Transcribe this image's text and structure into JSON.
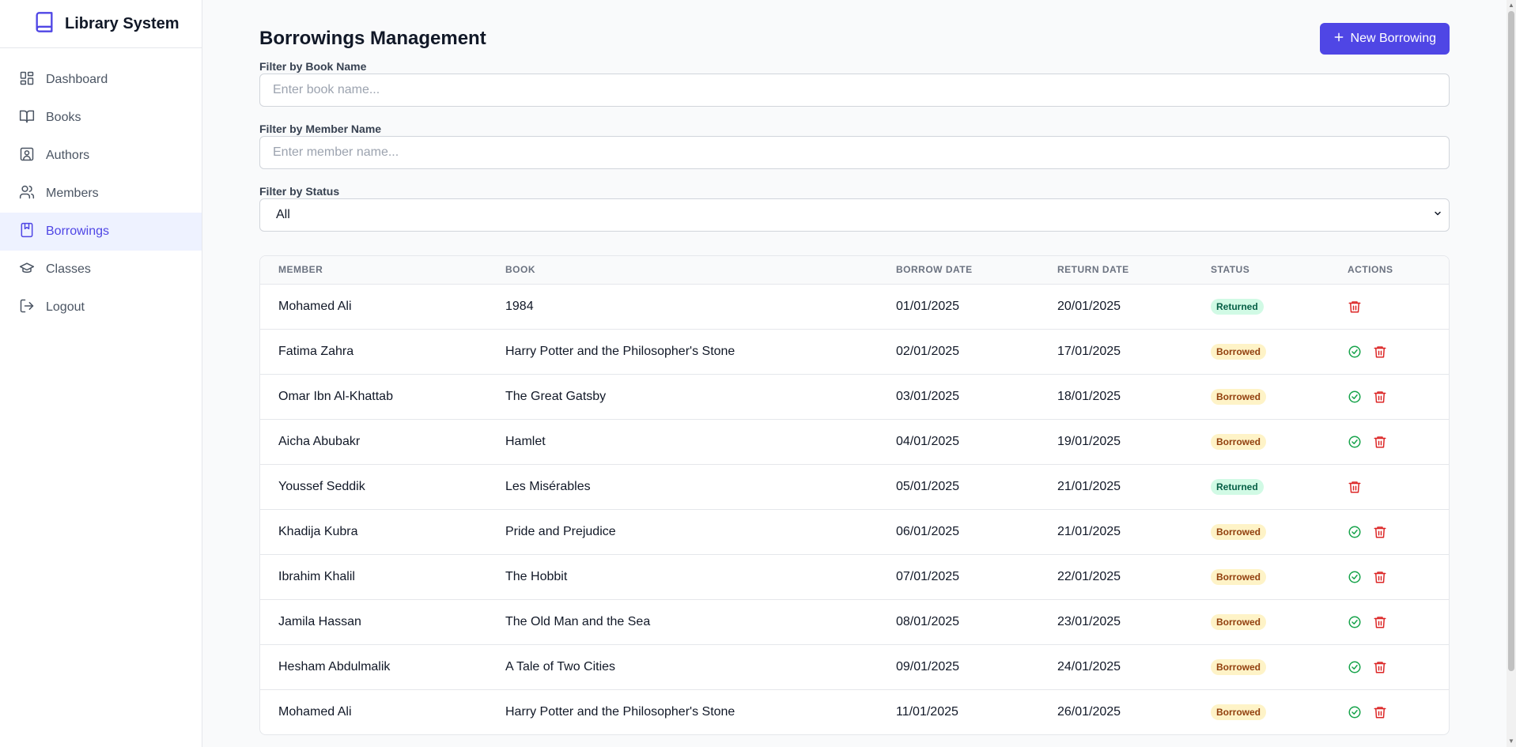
{
  "app": {
    "title": "Library System"
  },
  "colors": {
    "accent": "#4f46e5",
    "returned_bg": "#d1fae5",
    "borrowed_bg": "#fef3c7",
    "delete": "#dc2626",
    "approve": "#16a34a"
  },
  "sidebar": {
    "items": [
      {
        "label": "Dashboard",
        "icon": "dashboard-icon"
      },
      {
        "label": "Books",
        "icon": "book-open-icon"
      },
      {
        "label": "Authors",
        "icon": "author-icon"
      },
      {
        "label": "Members",
        "icon": "users-icon"
      },
      {
        "label": "Borrowings",
        "icon": "bookmark-book-icon",
        "active": true
      },
      {
        "label": "Classes",
        "icon": "graduation-cap-icon"
      },
      {
        "label": "Logout",
        "icon": "logout-icon"
      }
    ]
  },
  "header": {
    "title": "Borrowings Management",
    "new_button": "New Borrowing"
  },
  "filters": {
    "book": {
      "label": "Filter by Book Name",
      "placeholder": "Enter book name..."
    },
    "member": {
      "label": "Filter by Member Name",
      "placeholder": "Enter member name..."
    },
    "status": {
      "label": "Filter by Status",
      "selected": "All"
    }
  },
  "table": {
    "columns": [
      "Member",
      "Book",
      "Borrow Date",
      "Return Date",
      "Status",
      "Actions"
    ],
    "rows": [
      {
        "member": "Mohamed Ali",
        "book": "1984",
        "borrow_date": "01/01/2025",
        "return_date": "20/01/2025",
        "status": "Returned"
      },
      {
        "member": "Fatima Zahra",
        "book": "Harry Potter and the Philosopher's Stone",
        "borrow_date": "02/01/2025",
        "return_date": "17/01/2025",
        "status": "Borrowed"
      },
      {
        "member": "Omar Ibn Al-Khattab",
        "book": "The Great Gatsby",
        "borrow_date": "03/01/2025",
        "return_date": "18/01/2025",
        "status": "Borrowed"
      },
      {
        "member": "Aicha Abubakr",
        "book": "Hamlet",
        "borrow_date": "04/01/2025",
        "return_date": "19/01/2025",
        "status": "Borrowed"
      },
      {
        "member": "Youssef Seddik",
        "book": "Les Misérables",
        "borrow_date": "05/01/2025",
        "return_date": "21/01/2025",
        "status": "Returned"
      },
      {
        "member": "Khadija Kubra",
        "book": "Pride and Prejudice",
        "borrow_date": "06/01/2025",
        "return_date": "21/01/2025",
        "status": "Borrowed"
      },
      {
        "member": "Ibrahim Khalil",
        "book": "The Hobbit",
        "borrow_date": "07/01/2025",
        "return_date": "22/01/2025",
        "status": "Borrowed"
      },
      {
        "member": "Jamila Hassan",
        "book": "The Old Man and the Sea",
        "borrow_date": "08/01/2025",
        "return_date": "23/01/2025",
        "status": "Borrowed"
      },
      {
        "member": "Hesham Abdulmalik",
        "book": "A Tale of Two Cities",
        "borrow_date": "09/01/2025",
        "return_date": "24/01/2025",
        "status": "Borrowed"
      },
      {
        "member": "Mohamed Ali",
        "book": "Harry Potter and the Philosopher's Stone",
        "borrow_date": "11/01/2025",
        "return_date": "26/01/2025",
        "status": "Borrowed"
      }
    ]
  }
}
